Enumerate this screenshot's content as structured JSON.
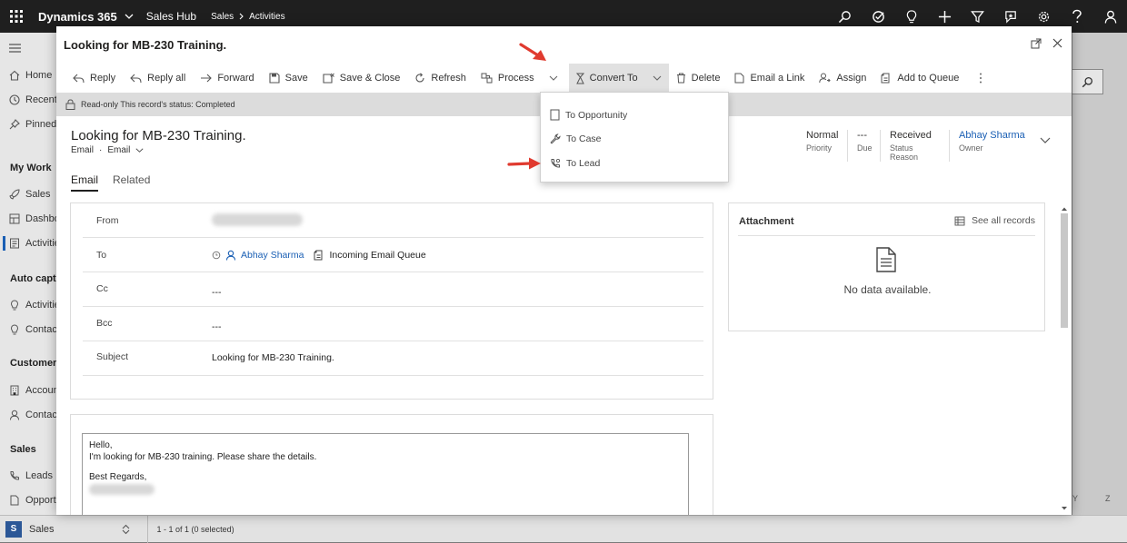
{
  "topbar": {
    "app_name": "Dynamics 365",
    "hub": "Sales Hub",
    "crumb_1": "Sales",
    "crumb_2": "Activities",
    "icons": [
      "search-icon",
      "task-icon",
      "lightbulb-icon",
      "plus-icon",
      "filter-icon",
      "assistant-icon",
      "gear-icon",
      "help-icon",
      "user-icon"
    ]
  },
  "sidebar": {
    "items": [
      {
        "label": "Home",
        "icon": "home-icon"
      },
      {
        "label": "Recent",
        "icon": "clock-icon"
      },
      {
        "label": "Pinned",
        "icon": "pin-icon"
      },
      {
        "label": "My Work",
        "icon": ""
      },
      {
        "label": "Sales",
        "icon": "rocket-icon"
      },
      {
        "label": "Dashboards",
        "icon": "dashboard-icon"
      },
      {
        "label": "Activities",
        "icon": "activity-icon"
      },
      {
        "label": "Auto capture",
        "icon": ""
      },
      {
        "label": "Activities",
        "icon": "bulb-icon"
      },
      {
        "label": "Contacts",
        "icon": "bulb-icon"
      },
      {
        "label": "Customers",
        "icon": ""
      },
      {
        "label": "Accounts",
        "icon": "building-icon"
      },
      {
        "label": "Contacts",
        "icon": "person-icon"
      },
      {
        "label": "Sales",
        "icon": ""
      },
      {
        "label": "Leads",
        "icon": "phone-icon"
      },
      {
        "label": "Opportunities",
        "icon": "doc-icon"
      }
    ]
  },
  "background": {
    "right_col_1": "Y",
    "right_col_2": "Z"
  },
  "statusbar": {
    "area_letter": "S",
    "area_name": "Sales",
    "record_count": "1 - 1 of 1 (0 selected)"
  },
  "dialog": {
    "title": "Looking for MB-230 Training.",
    "commands": {
      "reply": "Reply",
      "reply_all": "Reply all",
      "forward": "Forward",
      "save": "Save",
      "save_close": "Save & Close",
      "refresh": "Refresh",
      "process": "Process",
      "convert_to": "Convert To",
      "delete": "Delete",
      "email_link": "Email a Link",
      "assign": "Assign",
      "add_to_queue": "Add to Queue"
    },
    "readonly_notice": "Read-only This record's status: Completed"
  },
  "record": {
    "title": "Looking for MB-230 Training.",
    "entity": "Email",
    "dot": "·",
    "form_name": "Email",
    "header_fields": [
      {
        "value": "Normal",
        "label": "Priority"
      },
      {
        "value": "---",
        "label": "Due"
      },
      {
        "value": "Received",
        "label": "Status Reason"
      },
      {
        "value": "Abhay Sharma",
        "label": "Owner"
      }
    ],
    "tabs": {
      "email": "Email",
      "related": "Related"
    }
  },
  "form": {
    "from_label": "From",
    "to_label": "To",
    "to_recipient_1": "Abhay Sharma",
    "to_recipient_2": "Incoming Email Queue",
    "cc_label": "Cc",
    "cc_value": "---",
    "bcc_label": "Bcc",
    "bcc_value": "---",
    "subject_label": "Subject",
    "subject_value": "Looking for MB-230 Training."
  },
  "email_body": {
    "line1": "Hello,",
    "line2": "I'm looking for MB-230 training. Please share the details.",
    "line3": "Best Regards,"
  },
  "attachment": {
    "title": "Attachment",
    "see_all": "See all records",
    "empty": "No data available."
  },
  "convert_menu": {
    "items": [
      "To Opportunity",
      "To Case",
      "To Lead"
    ]
  },
  "colors": {
    "topbar": "#1f1f1f",
    "link": "#1a5fb4",
    "arrow": "#e03a2f",
    "readonly_bar": "#dcdcdc"
  }
}
